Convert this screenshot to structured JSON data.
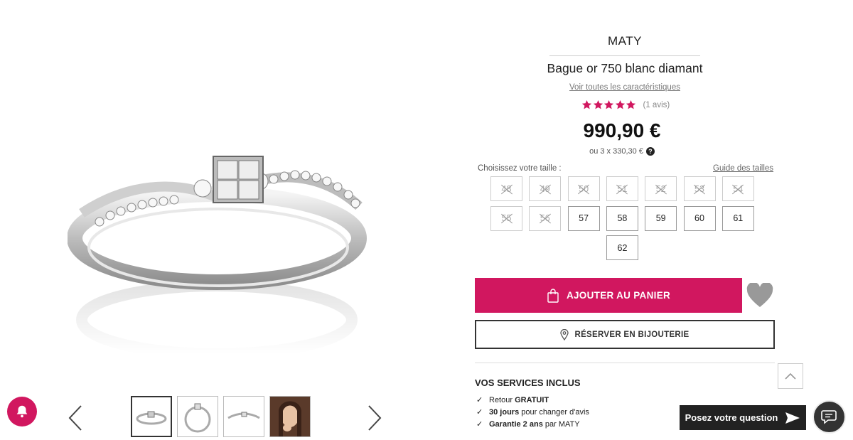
{
  "product": {
    "brand": "MATY",
    "title": "Bague or 750 blanc diamant",
    "see_specs_link": "Voir toutes les caractéristiques",
    "rating": 5,
    "review_count": "(1 avis)",
    "price": "990,90 €",
    "installments": "ou 3 x 330,30 €",
    "help_icon": "?"
  },
  "sizes": {
    "label": "Choisissez votre taille :",
    "guide_link": "Guide des tailles",
    "options": [
      {
        "value": "48",
        "available": false
      },
      {
        "value": "49",
        "available": false
      },
      {
        "value": "50",
        "available": false
      },
      {
        "value": "51",
        "available": false
      },
      {
        "value": "52",
        "available": false
      },
      {
        "value": "53",
        "available": false
      },
      {
        "value": "54",
        "available": false
      },
      {
        "value": "55",
        "available": false
      },
      {
        "value": "56",
        "available": false
      },
      {
        "value": "57",
        "available": true
      },
      {
        "value": "58",
        "available": true
      },
      {
        "value": "59",
        "available": true
      },
      {
        "value": "60",
        "available": true
      },
      {
        "value": "61",
        "available": true
      },
      {
        "value": "62",
        "available": true
      }
    ]
  },
  "actions": {
    "add_to_cart": "AJOUTER AU PANIER",
    "reserve": "RÉSERVER EN BIJOUTERIE"
  },
  "services": {
    "title": "VOS SERVICES INCLUS",
    "items": [
      {
        "prefix": "Retour ",
        "bold": "GRATUIT",
        "suffix": ""
      },
      {
        "prefix": "",
        "bold": "30 jours",
        "suffix": " pour changer d'avis"
      },
      {
        "prefix": "",
        "bold": "Garantie 2 ans",
        "suffix": " par MATY"
      }
    ]
  },
  "widgets": {
    "ask_question": "Posez votre question"
  },
  "colors": {
    "accent": "#d1175f",
    "dark": "#222222"
  },
  "icons": {
    "notification": "bell-icon",
    "cart": "shopping-bag-icon",
    "wishlist": "heart-icon",
    "location": "map-pin-icon",
    "scroll_top": "chevron-up-icon",
    "send": "send-icon",
    "chat": "chat-bubbles-icon",
    "prev": "chevron-left-icon",
    "next": "chevron-right-icon"
  }
}
